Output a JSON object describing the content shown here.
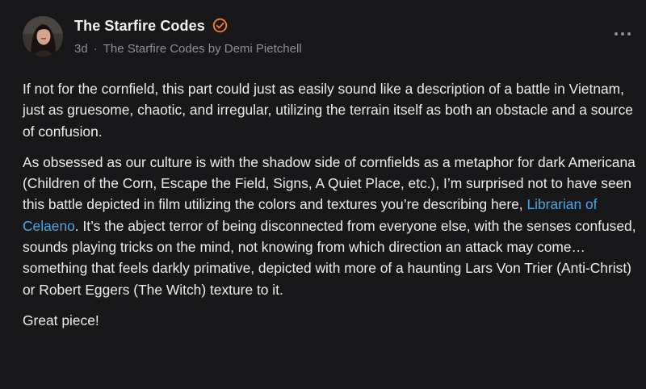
{
  "post": {
    "author_name": "The Starfire Codes",
    "age": "3d",
    "separator": "·",
    "publication": "The Starfire Codes by Demi Pietchell"
  },
  "icons": {
    "avatar": "avatar",
    "verified": "verified-badge-icon",
    "more": "more-horizontal-icon"
  },
  "colors": {
    "background": "#18181a",
    "text": "#ececec",
    "muted": "#8e8e93",
    "accent": "#f07b3a",
    "link": "#4ea6e0"
  },
  "comment": {
    "p1": "If not for the cornfield, this part could just as easily sound like a description of a battle in Vietnam, just as gruesome, chaotic, and irregular, utilizing the terrain itself as both an obstacle and a source of confusion.",
    "p2_before": "As obsessed as our culture is with the shadow side of cornfields as a metaphor for dark Americana (Children of the Corn, Escape the Field, Signs, A Quiet Place, etc.), I’m surprised not to have seen this battle depicted in film utilizing the colors and textures you’re describing here, ",
    "p2_link": "Librarian of Celaeno",
    "p2_after": ". It’s the abject terror of being disconnected from everyone else, with the senses confused, sounds playing tricks on the mind, not knowing from which direction an attack may come… something that feels darkly primative, depicted with more of a haunting Lars Von Trier (Anti-Christ) or Robert Eggers (The Witch) texture to it.",
    "p3": "Great piece!"
  }
}
